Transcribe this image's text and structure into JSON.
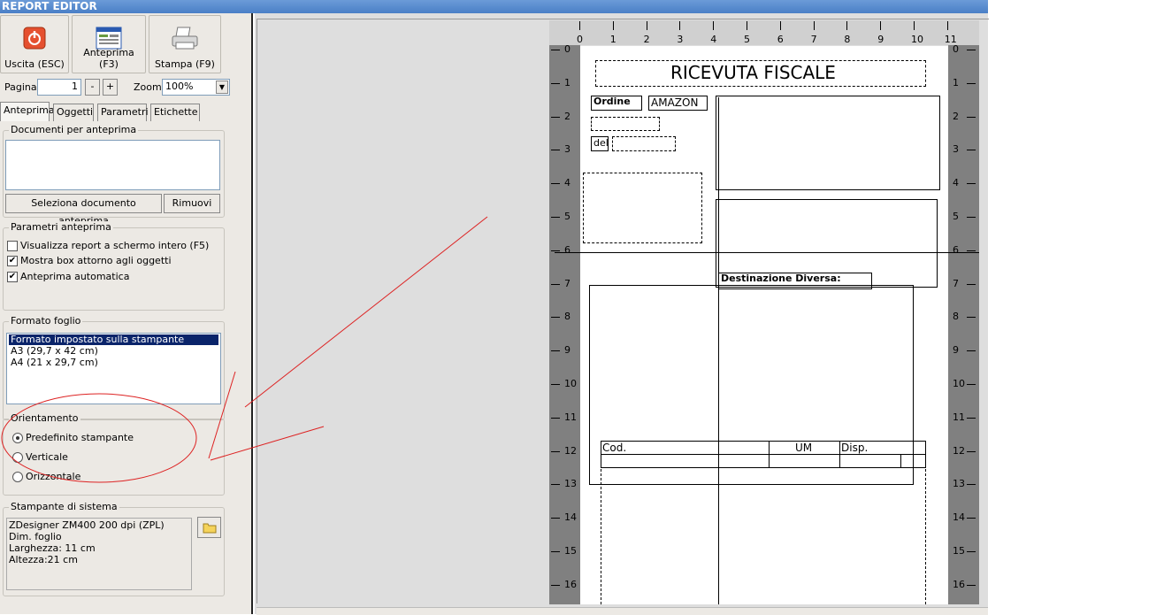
{
  "window": {
    "title": "REPORT EDITOR"
  },
  "toolbar": {
    "exit_label": "Uscita (ESC)",
    "preview_label": "Anteprima (F3)",
    "print_label": "Stampa (F9)"
  },
  "pager": {
    "page_label": "Pagina",
    "page_value": "1",
    "minus_label": "-",
    "plus_label": "+",
    "zoom_label": "Zoom",
    "zoom_value": "100%"
  },
  "tabs": [
    "Anteprima",
    "Oggetti",
    "Parametri",
    "Etichette"
  ],
  "documents_group": {
    "title": "Documenti per anteprima",
    "select_button": "Seleziona documento anteprima",
    "remove_button": "Rimuovi"
  },
  "preview_params": {
    "title": "Parametri anteprima",
    "options": [
      {
        "label": "Visualizza report a schermo intero (F5)",
        "checked": false
      },
      {
        "label": "Mostra box attorno agli oggetti",
        "checked": true
      },
      {
        "label": "Anteprima automatica",
        "checked": true
      }
    ]
  },
  "sheet_format": {
    "title": "Formato foglio",
    "items": [
      "Formato impostato sulla stampante",
      "A3 (29,7 x 42 cm)",
      "A4 (21 x 29,7 cm)"
    ],
    "selected_index": 0
  },
  "orientation": {
    "title": "Orientamento",
    "options": [
      "Predefinito stampante",
      "Verticale",
      "Orizzontale"
    ],
    "selected_index": 0
  },
  "system_printer": {
    "title": "Stampante di sistema",
    "lines": [
      "ZDesigner ZM400 200 dpi (ZPL)",
      "Dim. foglio",
      "Larghezza: 11 cm",
      "Altezza:21 cm"
    ]
  },
  "ruler": {
    "top_labels": [
      "0",
      "1",
      "2",
      "3",
      "4",
      "5",
      "6",
      "7",
      "8",
      "9",
      "10",
      "11"
    ],
    "side_labels": [
      "0",
      "1",
      "2",
      "3",
      "4",
      "5",
      "6",
      "7",
      "8",
      "9",
      "10",
      "11",
      "12",
      "13",
      "14",
      "15",
      "16"
    ]
  },
  "report": {
    "title": "RICEVUTA FISCALE",
    "order_label": "Ordine",
    "order_value": "AMAZON",
    "del_label": "del",
    "destination_label": "Destinazione Diversa:",
    "table_headers": [
      "Cod.",
      "",
      "UM",
      "Disp."
    ]
  },
  "colors": {
    "titlebar": "#5588cc",
    "panel": "#ece9e4",
    "workarea": "#dedede",
    "selection": "#0a246a",
    "annotation": "#dd2222",
    "ruler": "#808080"
  }
}
